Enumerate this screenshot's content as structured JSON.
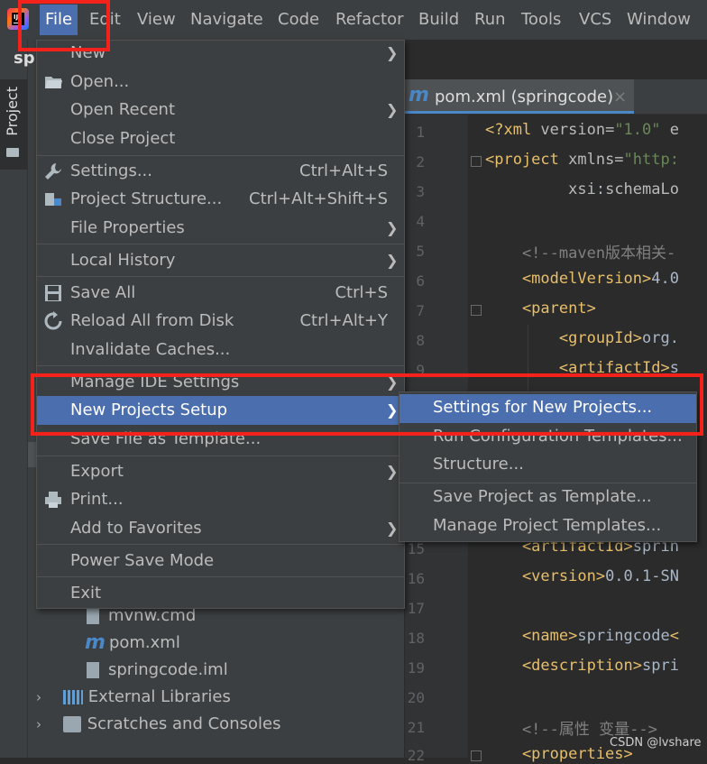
{
  "menubar": {
    "items": [
      "File",
      "Edit",
      "View",
      "Navigate",
      "Code",
      "Refactor",
      "Build",
      "Run",
      "Tools",
      "VCS",
      "Window"
    ],
    "active": "File"
  },
  "tool_window": {
    "tab_label": "Project",
    "header_text": "spi"
  },
  "project_tree": {
    "rows": [
      {
        "label": "mvnw.cmd",
        "icon": "file-icon"
      },
      {
        "label": "pom.xml",
        "icon": "maven-icon"
      },
      {
        "label": "springcode.iml",
        "icon": "module-file-icon"
      },
      {
        "label": "External Libraries",
        "icon": "libraries-icon"
      },
      {
        "label": "Scratches and Consoles",
        "icon": "scratches-icon"
      }
    ]
  },
  "editor": {
    "tab_label": "pom.xml (springcode)",
    "tab_close": "×",
    "line_numbers": [
      "1",
      "2",
      "3",
      "4",
      "5",
      "6",
      "7",
      "8",
      "9",
      "15",
      "16",
      "17",
      "18",
      "19",
      "20",
      "21",
      "22"
    ]
  },
  "file_menu": {
    "items": [
      {
        "label": "New",
        "shortcut": "",
        "submenu": true,
        "icon": ""
      },
      {
        "label": "Open...",
        "shortcut": "",
        "submenu": false,
        "icon": "folder-open-icon"
      },
      {
        "label": "Open Recent",
        "shortcut": "",
        "submenu": true,
        "icon": ""
      },
      {
        "label": "Close Project",
        "shortcut": "",
        "submenu": false,
        "icon": ""
      },
      {
        "label": "Settings...",
        "shortcut": "Ctrl+Alt+S",
        "submenu": false,
        "icon": "wrench-icon"
      },
      {
        "label": "Project Structure...",
        "shortcut": "Ctrl+Alt+Shift+S",
        "submenu": false,
        "icon": "project-structure-icon"
      },
      {
        "label": "File Properties",
        "shortcut": "",
        "submenu": true,
        "icon": ""
      },
      {
        "label": "Local History",
        "shortcut": "",
        "submenu": true,
        "icon": ""
      },
      {
        "label": "Save All",
        "shortcut": "Ctrl+S",
        "submenu": false,
        "icon": "save-icon"
      },
      {
        "label": "Reload All from Disk",
        "shortcut": "Ctrl+Alt+Y",
        "submenu": false,
        "icon": "reload-icon"
      },
      {
        "label": "Invalidate Caches...",
        "shortcut": "",
        "submenu": false,
        "icon": ""
      },
      {
        "label": "Manage IDE Settings",
        "shortcut": "",
        "submenu": true,
        "icon": ""
      },
      {
        "label": "New Projects Setup",
        "shortcut": "",
        "submenu": true,
        "icon": "",
        "selected": true
      },
      {
        "label": "Save File as Template...",
        "shortcut": "",
        "submenu": false,
        "icon": ""
      },
      {
        "label": "Export",
        "shortcut": "",
        "submenu": true,
        "icon": ""
      },
      {
        "label": "Print...",
        "shortcut": "",
        "submenu": false,
        "icon": "print-icon"
      },
      {
        "label": "Add to Favorites",
        "shortcut": "",
        "submenu": true,
        "icon": ""
      },
      {
        "label": "Power Save Mode",
        "shortcut": "",
        "submenu": false,
        "icon": ""
      },
      {
        "label": "Exit",
        "shortcut": "",
        "submenu": false,
        "icon": ""
      }
    ]
  },
  "submenu": {
    "items": [
      {
        "label": "Settings for New Projects...",
        "selected": true
      },
      {
        "label": "Run Configuration Templates..."
      },
      {
        "label": "Structure..."
      },
      {
        "label": "Save Project as Template..."
      },
      {
        "label": "Manage Project Templates..."
      }
    ]
  },
  "code_lines": [
    {
      "parts": [
        [
          "t",
          "<?xml "
        ],
        [
          "a",
          "version="
        ],
        [
          "v",
          "\"1.0\""
        ],
        [
          "a",
          " e"
        ]
      ]
    },
    {
      "parts": [
        [
          "t",
          "<project "
        ],
        [
          "a",
          "xmlns="
        ],
        [
          "v",
          "\"http:"
        ]
      ]
    },
    {
      "parts": [
        [
          "a",
          "         xsi"
        ],
        [
          "w",
          ":"
        ],
        [
          "a",
          "schemaLo"
        ]
      ]
    },
    {
      "parts": []
    },
    {
      "parts": [
        [
          "c",
          "    <!--maven版本相关-"
        ]
      ]
    },
    {
      "parts": [
        [
          "t",
          "    <modelVersion>"
        ],
        [
          "w",
          "4.0"
        ]
      ]
    },
    {
      "parts": [
        [
          "t",
          "    <parent>"
        ]
      ]
    },
    {
      "parts": [
        [
          "t",
          "        <groupId>"
        ],
        [
          "w",
          "org."
        ]
      ]
    },
    {
      "parts": [
        [
          "t",
          "        <artifactId>"
        ],
        [
          "w",
          "s"
        ]
      ]
    },
    {
      "parts": [
        [
          "w",
          "                 e"
        ]
      ]
    },
    {
      "parts": [
        [
          "t",
          "    <artifactId>"
        ],
        [
          "w",
          "sprin"
        ]
      ]
    },
    {
      "parts": [
        [
          "t",
          "    <version>"
        ],
        [
          "w",
          "0.0.1-SN"
        ]
      ]
    },
    {
      "parts": []
    },
    {
      "parts": [
        [
          "t",
          "    <name>"
        ],
        [
          "w",
          "springcode"
        ],
        [
          "t",
          "<"
        ]
      ]
    },
    {
      "parts": [
        [
          "t",
          "    <description>"
        ],
        [
          "w",
          "spri"
        ]
      ]
    },
    {
      "parts": []
    },
    {
      "parts": [
        [
          "c",
          "    <!--属性 变量-->"
        ]
      ]
    },
    {
      "parts": [
        [
          "t",
          "    <properties>"
        ]
      ]
    }
  ],
  "watermark": "CSDN @lvshare",
  "colors": {
    "menu_bg": "#3c3f41",
    "selection": "#4b6eaf",
    "editor_bg": "#2b2b2b",
    "annotation_red": "#f5211b"
  }
}
